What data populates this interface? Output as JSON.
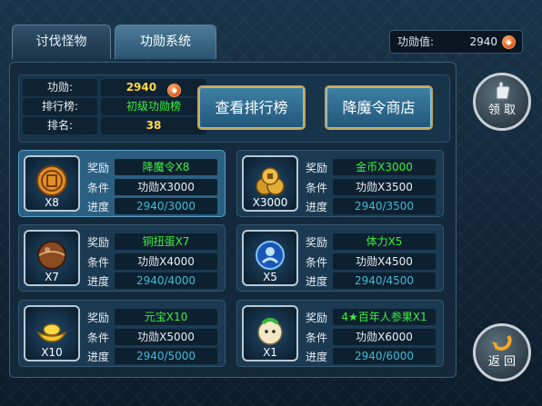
{
  "tabs": [
    {
      "label": "讨伐怪物"
    },
    {
      "label": "功勋系统"
    }
  ],
  "header": {
    "merit_label": "功勋值:",
    "merit_value": "2940"
  },
  "info": {
    "merit_label": "功勋:",
    "merit_value": "2940",
    "rank_board_label": "排行榜:",
    "rank_board_value": "初级功勋榜",
    "rank_label": "排名:",
    "rank_value": "38"
  },
  "buttons": {
    "view_rank": "查看排行榜",
    "shop": "降魔令商店",
    "claim": "领 取",
    "back": "返 回"
  },
  "labels": {
    "reward": "奖励",
    "condition": "条件",
    "progress": "进度"
  },
  "cards": [
    {
      "icon": "token-icon",
      "qty": "X8",
      "reward": "降魔令X8",
      "condition": "功勋X3000",
      "progress": "2940/3000"
    },
    {
      "icon": "gold-coins-icon",
      "qty": "X3000",
      "reward": "金币X3000",
      "condition": "功勋X3500",
      "progress": "2940/3500"
    },
    {
      "icon": "copper-egg-icon",
      "qty": "X7",
      "reward": "铜扭蛋X7",
      "condition": "功勋X4000",
      "progress": "2940/4000"
    },
    {
      "icon": "stamina-orb-icon",
      "qty": "X5",
      "reward": "体力X5",
      "condition": "功勋X4500",
      "progress": "2940/4500"
    },
    {
      "icon": "gold-ingot-icon",
      "qty": "X10",
      "reward": "元宝X10",
      "condition": "功勋X5000",
      "progress": "2940/5000"
    },
    {
      "icon": "ginseng-icon",
      "qty": "X1",
      "reward": "4★百年人参果X1",
      "condition": "功勋X6000",
      "progress": "2940/6000"
    }
  ],
  "colors": {
    "reward_text": "#3df03d",
    "progress_text": "#43b9d3",
    "merit_value": "#ffd84a",
    "rank_board": "#3df03d"
  }
}
